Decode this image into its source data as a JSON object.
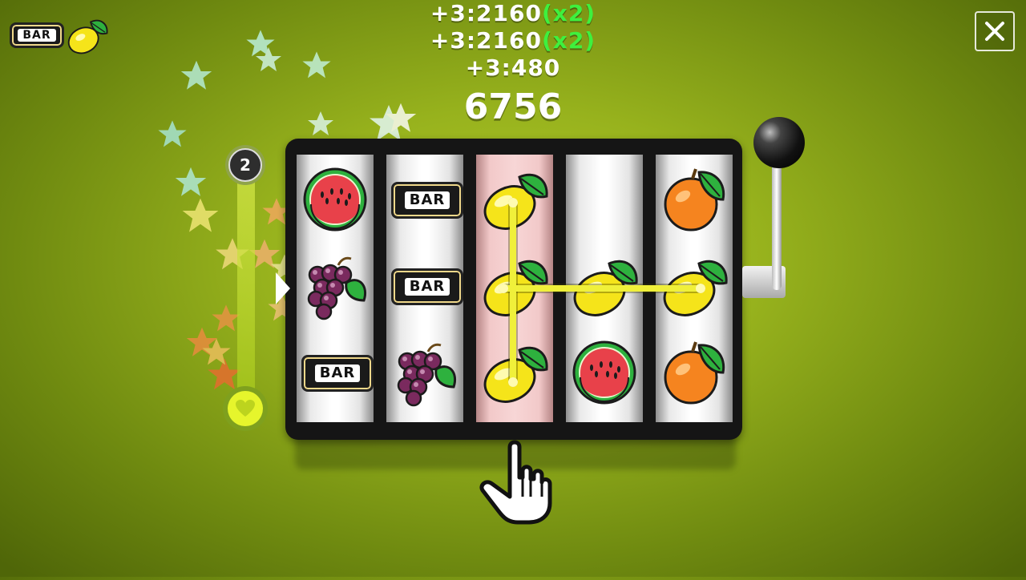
{
  "hud": {
    "next_combo_bar_label": "BAR",
    "next_combo_icon": "lemon-icon",
    "close_icon": "close-icon"
  },
  "score": {
    "lines": [
      {
        "value": "+3:2160",
        "multiplier": "(x2)"
      },
      {
        "value": "+3:2160",
        "multiplier": "(x2)"
      },
      {
        "value": "+3:480",
        "multiplier": ""
      }
    ],
    "total": "6756"
  },
  "bet": {
    "level": "2",
    "heart_icon": "heart-icon"
  },
  "reels": [
    [
      "watermelon",
      "grapes",
      "bar"
    ],
    [
      "bar",
      "bar",
      "grapes"
    ],
    [
      "lemon",
      "lemon",
      "lemon"
    ],
    [
      "blank",
      "lemon",
      "watermelon"
    ],
    [
      "orange",
      "lemon",
      "orange"
    ]
  ],
  "bar_label": "BAR",
  "highlighted_reel": 2,
  "colors": {
    "background": "#97b21d",
    "multiplier": "#3ef03e",
    "win_line": "#f0f03a"
  }
}
